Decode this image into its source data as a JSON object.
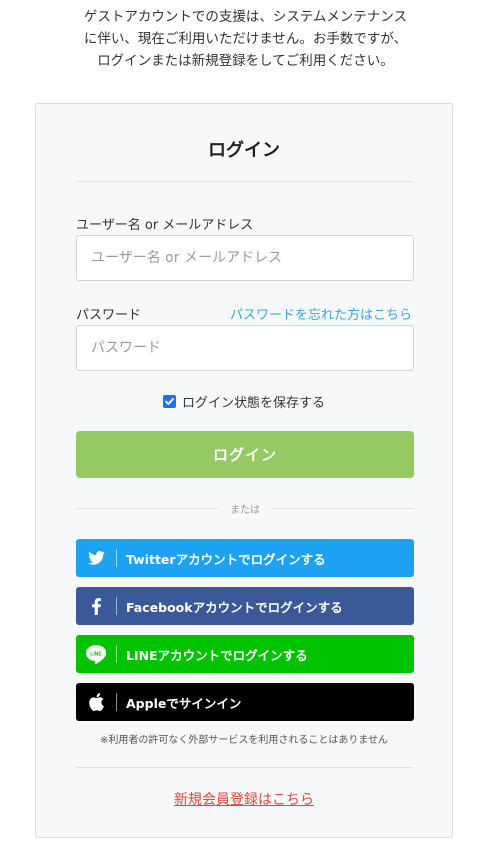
{
  "notice": {
    "lines": [
      "ゲストアカウントでの支援は、システムメンテナンス",
      "に伴い、現在ご利用いただけません。お手数ですが、",
      "ログインまたは新規登録をしてご利用ください。"
    ]
  },
  "login": {
    "title": "ログイン",
    "username_label": "ユーザー名 or メールアドレス",
    "username_placeholder": "ユーザー名 or メールアドレス",
    "password_label": "パスワード",
    "forgot_link": "パスワードを忘れた方はこちら",
    "password_placeholder": "パスワード",
    "remember_label": "ログイン状態を保存する",
    "remember_checked": true,
    "submit_label": "ログイン"
  },
  "divider_text": "または",
  "social": {
    "twitter": "Twitterアカウントでログインする",
    "facebook": "Facebookアカウントでログインする",
    "line": "LINEアカウントでログインする",
    "apple": "Appleでサインイン"
  },
  "privacy_note": "※利用者の許可なく外部サービスを利用されることはありません",
  "register_link": "新規会員登録はこちら",
  "colors": {
    "login_button": "#95c964",
    "twitter": "#1da1f2",
    "facebook": "#3b5998",
    "line": "#00c300",
    "apple": "#000000",
    "link_blue": "#3aa6d6",
    "register_red": "#e0463c"
  },
  "icons": {
    "twitter": "twitter-bird-icon",
    "facebook": "facebook-f-icon",
    "line": "line-logo-icon",
    "apple": "apple-logo-icon",
    "checkbox": "checkmark-icon"
  }
}
